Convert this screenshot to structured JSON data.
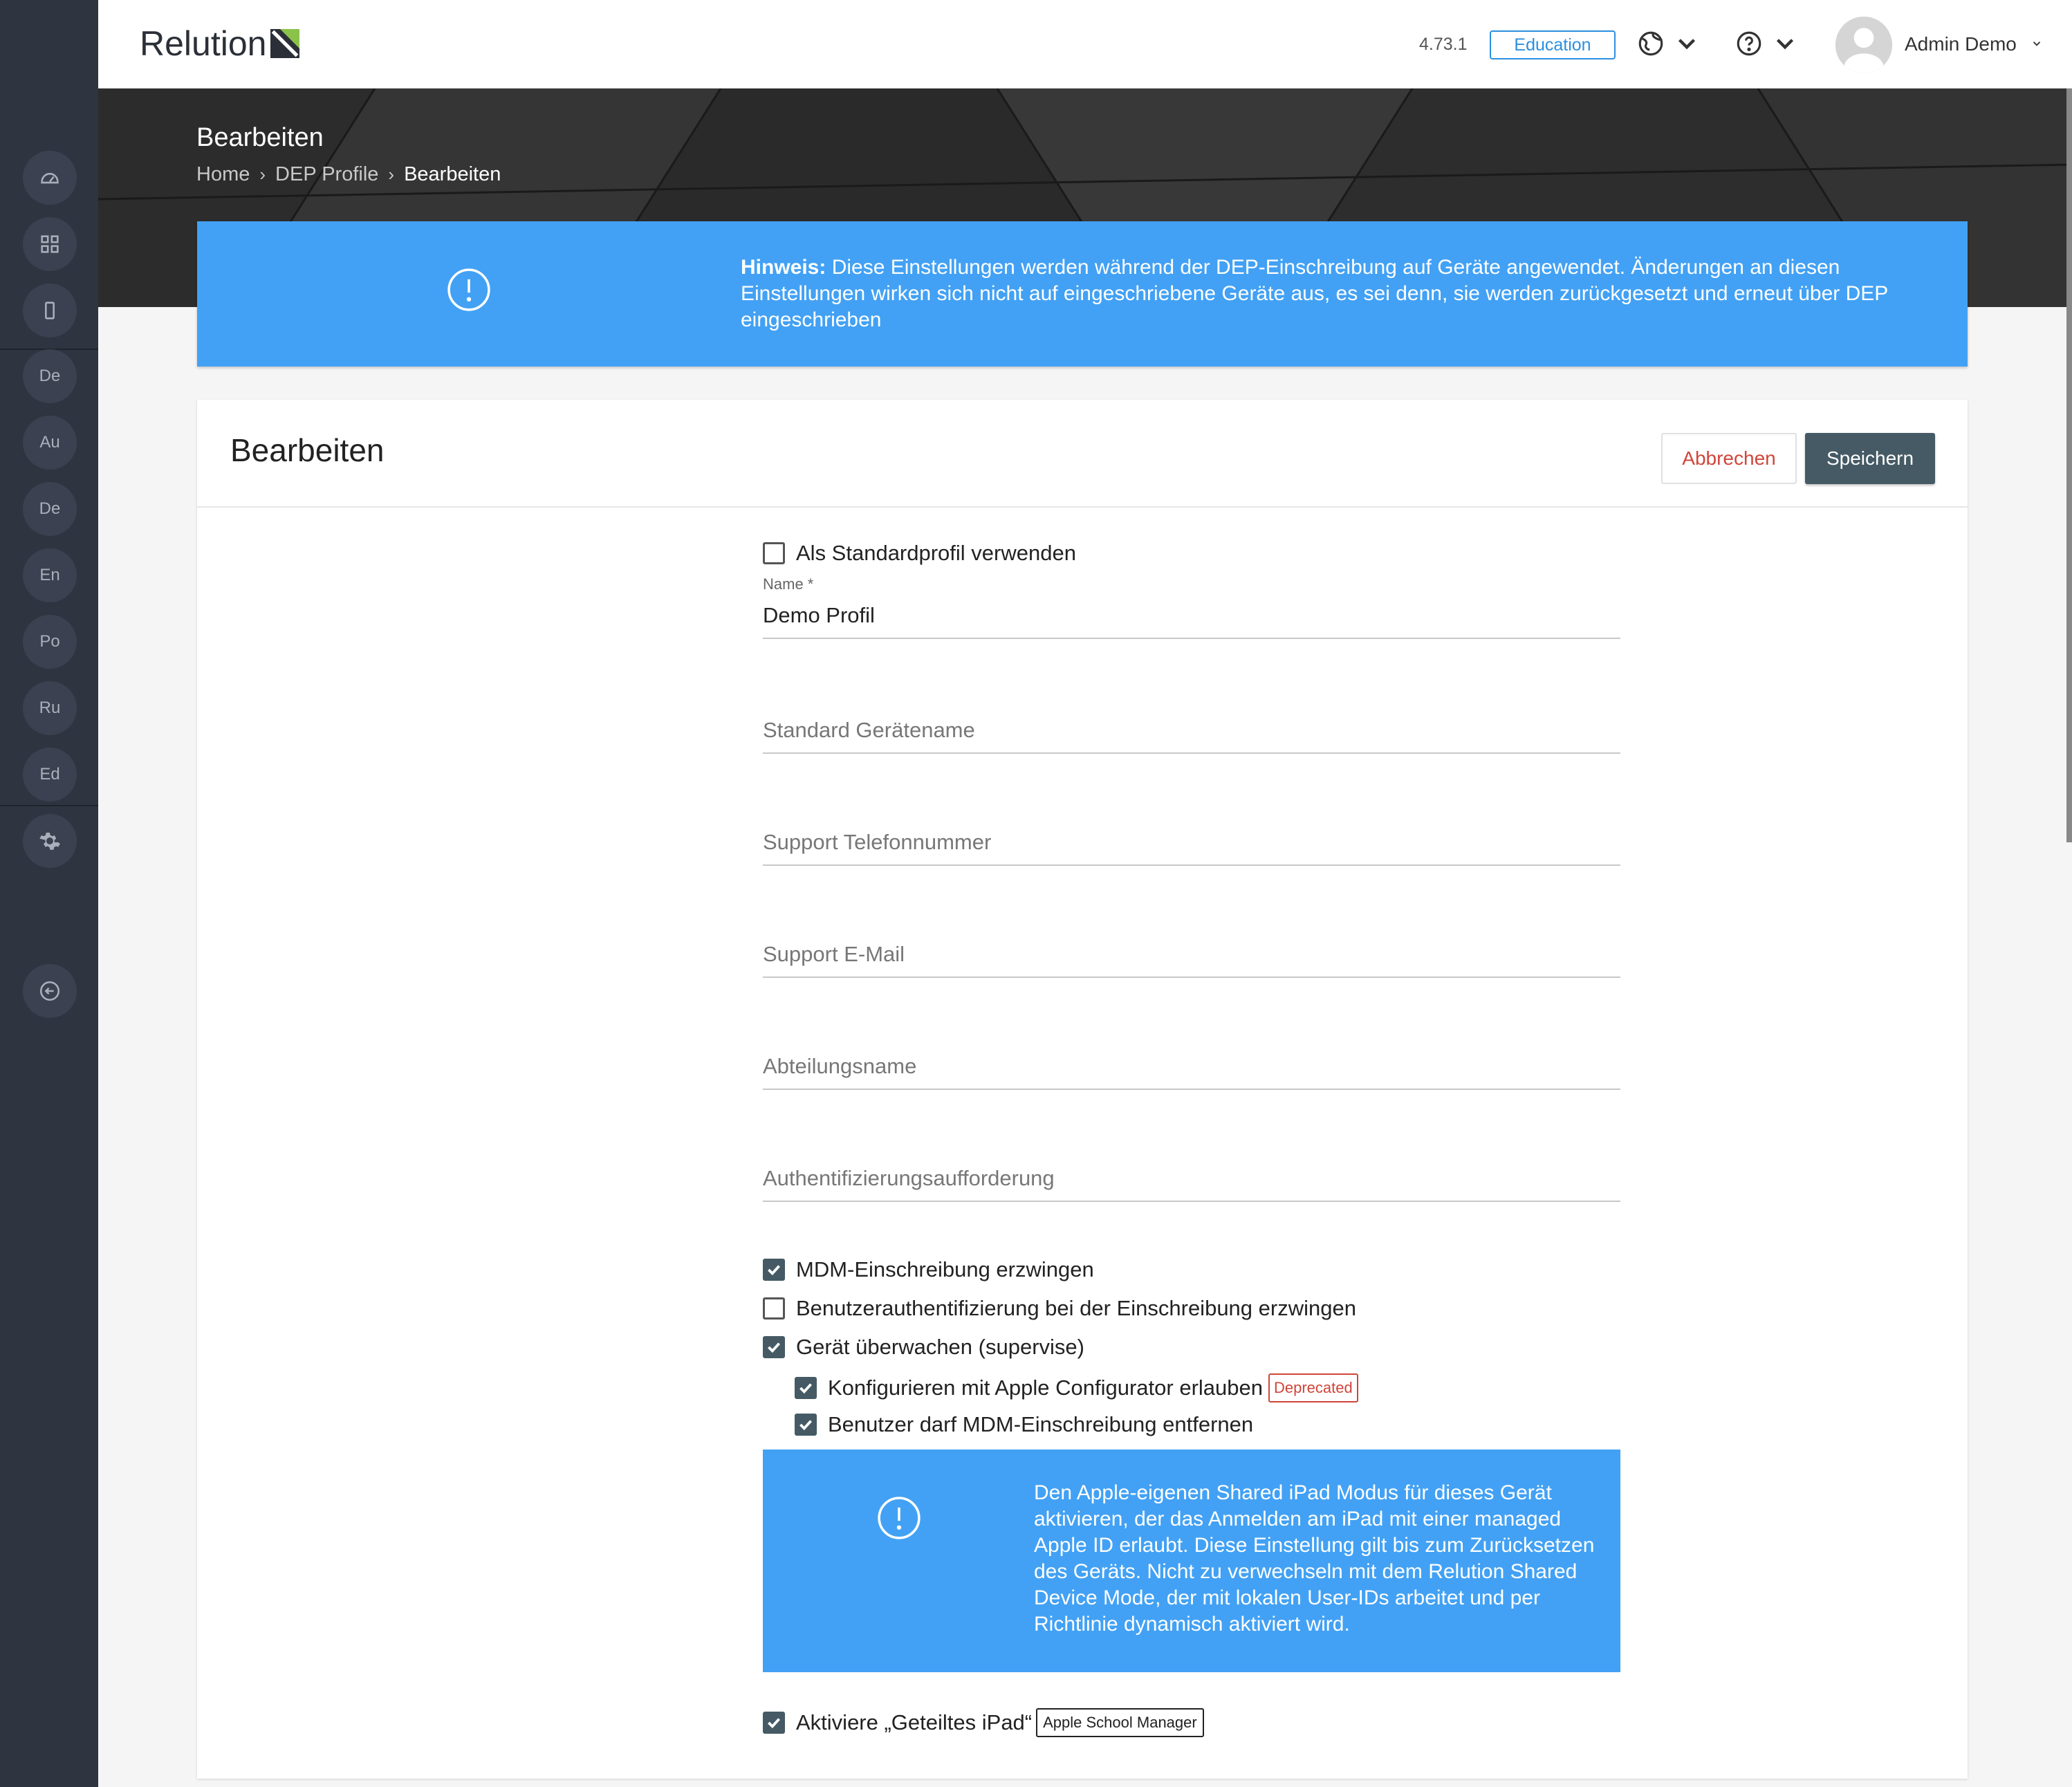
{
  "app": {
    "logo_text": "Relution",
    "version": "4.73.1",
    "edition_badge": "Education",
    "user_name": "Admin Demo"
  },
  "sidebar": {
    "items": [
      {
        "icon": "dashboard-icon"
      },
      {
        "icon": "apps-grid-icon"
      },
      {
        "icon": "device-icon"
      },
      {
        "label": "De"
      },
      {
        "label": "Au"
      },
      {
        "label": "De"
      },
      {
        "label": "En"
      },
      {
        "label": "Po"
      },
      {
        "label": "Ru"
      },
      {
        "label": "Ed"
      },
      {
        "icon": "gear-icon"
      },
      {
        "icon": "back-arrow-icon"
      }
    ]
  },
  "header": {
    "title": "Bearbeiten",
    "breadcrumb": [
      "Home",
      "DEP Profile",
      "Bearbeiten"
    ]
  },
  "notice": {
    "bold": "Hinweis:",
    "text": " Diese Einstellungen werden während der DEP-Einschreibung auf Geräte angewendet. Änderungen an diesen Einstellungen wirken sich nicht auf eingeschriebene Geräte aus, es sei denn, sie werden zurückgesetzt und erneut über DEP eingeschrieben"
  },
  "card": {
    "title": "Bearbeiten",
    "cancel_label": "Abbrechen",
    "save_label": "Speichern"
  },
  "form": {
    "default_profile": {
      "label": "Als Standardprofil verwenden",
      "checked": false
    },
    "name": {
      "label": "Name *",
      "value": "Demo Profil"
    },
    "device_name": {
      "placeholder": "Standard Gerätename"
    },
    "support_phone": {
      "placeholder": "Support Telefonnummer"
    },
    "support_email": {
      "placeholder": "Support E-Mail"
    },
    "department": {
      "placeholder": "Abteilungsname"
    },
    "auth_prompt": {
      "placeholder": "Authentifizierungsaufforderung"
    },
    "mdm_enforce": {
      "label": "MDM-Einschreibung erzwingen",
      "checked": true
    },
    "user_auth": {
      "label": "Benutzerauthentifizierung bei der Einschreibung erzwingen",
      "checked": false
    },
    "supervise": {
      "label": "Gerät überwachen (supervise)",
      "checked": true
    },
    "configurator": {
      "label": "Konfigurieren mit Apple Configurator erlauben",
      "checked": true,
      "tag": "Deprecated"
    },
    "remove_mdm": {
      "label": "Benutzer darf MDM-Einschreibung entfernen",
      "checked": true
    },
    "shared_ipad_info": "Den Apple-eigenen Shared iPad Modus für dieses Gerät aktivieren, der das Anmelden am iPad mit einer managed Apple ID erlaubt. Diese Einstellung gilt bis zum Zurücksetzen des Geräts. Nicht zu verwechseln mit dem Relution Shared Device Mode, der mit lokalen User-IDs arbeitet und per Richtlinie dynamisch aktiviert wird.",
    "shared_ipad": {
      "label": "Aktiviere „Geteiltes iPad“",
      "checked": true,
      "tag": "Apple School Manager"
    }
  },
  "colors": {
    "accent_blue": "#42a1f4",
    "primary_button": "#455a64",
    "danger": "#d0453a",
    "sidebar": "#2f3441"
  }
}
